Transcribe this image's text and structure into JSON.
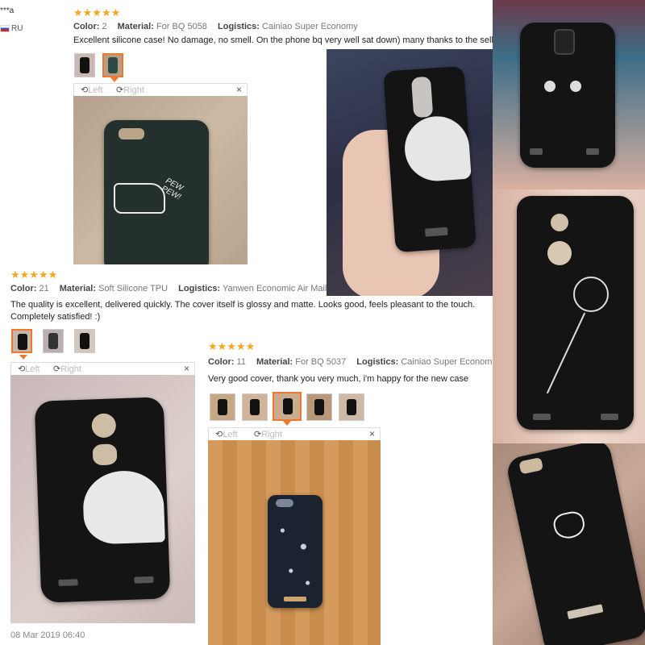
{
  "review1": {
    "user": "***a",
    "country": "RU",
    "stars": "★★★★★",
    "color_label": "Color:",
    "color_value": "2",
    "material_label": "Material:",
    "material_value": "For BQ 5058",
    "logistics_label": "Logistics:",
    "logistics_value": "Cainiao Super Economy",
    "text": "Excellent silicone case! No damage, no smell. On the phone bq very well sat down) many thanks to the seller!",
    "viewer": {
      "left": "Left",
      "right": "Right",
      "close": "×"
    },
    "phone_text": "PEW PEW!"
  },
  "review2": {
    "stars": "★★★★★",
    "color_label": "Color:",
    "color_value": "21",
    "material_label": "Material:",
    "material_value": "Soft Silicone TPU",
    "logistics_label": "Logistics:",
    "logistics_value": "Yanwen Economic Air Mail",
    "text": "The quality is excellent, delivered quickly. The cover itself is glossy and matte. Looks good, feels pleasant to the touch. Completely satisfied! :)",
    "viewer": {
      "left": "Left",
      "right": "Right",
      "close": "×"
    },
    "date": "08 Mar 2019 06:40"
  },
  "review3": {
    "stars": "★★★★★",
    "color_label": "Color:",
    "color_value": "11",
    "material_label": "Material:",
    "material_value": "For BQ 5037",
    "logistics_label": "Logistics:",
    "logistics_value": "Cainiao Super Econom",
    "text": "Very good cover, thank you very much, i'm happy for the new case",
    "viewer": {
      "left": "Left",
      "right": "Right",
      "close": "×"
    }
  },
  "colors": {
    "star": "#f5a623",
    "accent": "#f0782d",
    "case": "#141414"
  }
}
